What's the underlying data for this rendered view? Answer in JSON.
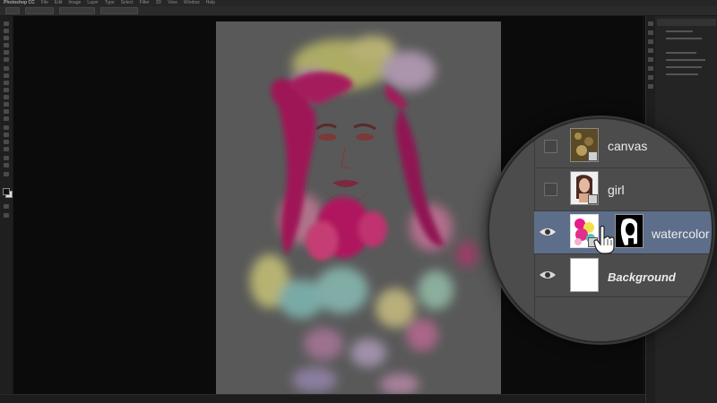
{
  "app": {
    "name": "Photoshop CC"
  },
  "menubar": {
    "items": [
      "File",
      "Edit",
      "Image",
      "Layer",
      "Type",
      "Select",
      "Filter",
      "3D",
      "View",
      "Window",
      "Help"
    ]
  },
  "layers": [
    {
      "name": "canvas",
      "visible": false,
      "selected": false,
      "has_mask": false,
      "thumb": "canvas-texture",
      "italic": false
    },
    {
      "name": "girl",
      "visible": false,
      "selected": false,
      "has_mask": false,
      "thumb": "girl-photo",
      "italic": false
    },
    {
      "name": "watercolor",
      "visible": true,
      "selected": true,
      "has_mask": true,
      "thumb": "watercolor-splash",
      "italic": false
    },
    {
      "name": "Background",
      "visible": true,
      "selected": false,
      "has_mask": false,
      "thumb": "white",
      "italic": true
    }
  ],
  "icons": {
    "eye": "eye-icon",
    "link": "smart-object-icon",
    "cursor": "hand-pointer-icon"
  },
  "colors": {
    "selected_layer": "#5d6e8a",
    "canvas_bg": "#595959",
    "workspace_bg": "#0b0b0b",
    "magenta": "#b1185f"
  }
}
